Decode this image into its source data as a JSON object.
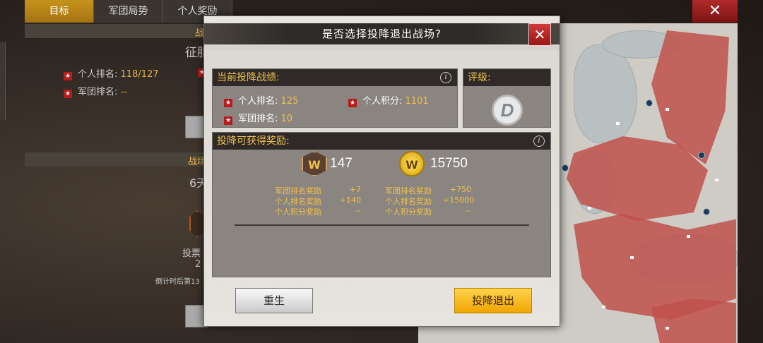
{
  "top_tabs": [
    {
      "label": "目标",
      "active": true
    },
    {
      "label": "军团局势",
      "active": false
    },
    {
      "label": "个人奖励",
      "active": false
    }
  ],
  "close_glyph": "✕",
  "background": {
    "section1_title": "战",
    "conquer_text": "征服",
    "personal_rank_label": "个人排名:",
    "personal_rank_value": "118/127",
    "legion_rank_label": "军团排名:",
    "legion_rank_value": "--",
    "section2_title": "战场",
    "days_text": "6天",
    "vote_text": "投票",
    "vote_sub": "2",
    "countdown_text": "倒计时后第13"
  },
  "dialog": {
    "title": "是否选择投降退出战场?",
    "current_stats": {
      "header": "当前投降战绩:",
      "personal_rank_label": "个人排名:",
      "personal_rank_value": "125",
      "personal_score_label": "个人积分:",
      "personal_score_value": "1101",
      "legion_rank_label": "军团排名:",
      "legion_rank_value": "10"
    },
    "rating": {
      "header": "评级:",
      "grade": "D"
    },
    "rewards": {
      "header": "投降可获得奖励:",
      "currency1_icon": "W",
      "currency1_amount": "147",
      "currency2_icon": "W",
      "currency2_amount": "15750",
      "col1": [
        {
          "label": "军团排名奖励",
          "value": "+7"
        },
        {
          "label": "个人排名奖励",
          "value": "+140"
        },
        {
          "label": "个人积分奖励",
          "value": "--"
        }
      ],
      "col2": [
        {
          "label": "军团排名奖励",
          "value": "+750"
        },
        {
          "label": "个人排名奖励",
          "value": "+15000"
        },
        {
          "label": "个人积分奖励",
          "value": "--"
        }
      ]
    },
    "respawn_label": "重生",
    "surrender_label": "投降退出"
  },
  "colors": {
    "accent_gold": "#f0c14b",
    "close_red": "#b02a2a",
    "surrender_yellow": "#f0a500",
    "territory_red": "#c0504b"
  },
  "icons": {
    "close": "close-icon",
    "info": "info-icon",
    "star": "star-icon",
    "grade": "grade-d-badge",
    "medal": "hex-medal-icon",
    "coin": "gold-coin-icon"
  }
}
